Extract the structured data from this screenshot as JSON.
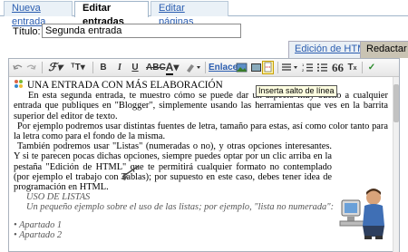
{
  "tabs": [
    {
      "label": "Nueva entrada"
    },
    {
      "label": "Editar entradas"
    },
    {
      "label": "Editar páginas"
    }
  ],
  "title_field": {
    "label": "Título:",
    "value": "Segunda entrada"
  },
  "mode_tabs": {
    "html": "Edición de HTML",
    "compose": "Redactar"
  },
  "toolbar": {
    "link_label": "Enlace",
    "tooltip": "Inserta salto de línea"
  },
  "content": {
    "heading": "UNA ENTRADA CON MÁS ELABORACIÓN",
    "p1": "En esta segunda entrada, te muestro cómo se puede dar un aspecto muy bueno a cualquier entrada que publiques en \"Blogger\", simplemente usando las herramientas que ves en la barrita superior del editor de texto.",
    "p2": "Por ejemplo podremos usar distintas fuentes de letra, tamaño para estas, así como color tanto para la letra como para el fondo de la misma.",
    "p3": "También podremos usar \"Listas\" (numeradas o no), y otras opciones interesantes. Y si te parecen pocas dichas opciones, siempre puedes optar por un clic arriba en la pestaña \"Edición de HTML\" que te permitirá cualquier formato no contemplado (por ejemplo el trabajo con Tablas); por supuesto en este caso, debes tener idea de programación en HTML.",
    "p4": "USO DE LISTAS",
    "p5": "Un pequeño ejemplo sobre el uso de las listas; por ejemplo, \"lista no numerada\":",
    "list": [
      "Apartado 1",
      "Apartado 2"
    ]
  },
  "colors": {
    "link": "#2a5db0",
    "tooltip_bg": "#ffffe1",
    "compose_tab": "#c9c3b3"
  }
}
